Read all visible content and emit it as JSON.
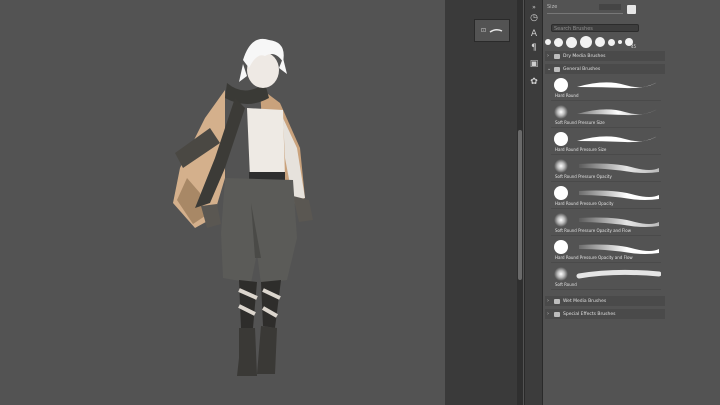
{
  "brush_panel": {
    "size_label": "Size",
    "search_placeholder": "Search Brushes",
    "preset_badge": "45",
    "groups": {
      "dry_media": "Dry Media Brushes",
      "general": "General Brushes",
      "wet_media": "Wet Media Brushes",
      "special_effects": "Special Effects Brushes"
    },
    "brushes": [
      {
        "label": "Hard Round",
        "tip": "hard",
        "stroke": "hard-taper"
      },
      {
        "label": "Soft Round Pressure Size",
        "tip": "soft",
        "stroke": "soft-taper"
      },
      {
        "label": "Hard Round Pressure Size",
        "tip": "hard",
        "stroke": "hard-taper"
      },
      {
        "label": "Soft Round Pressure Opacity",
        "tip": "soft",
        "stroke": "soft-fade"
      },
      {
        "label": "Hard Round Pressure Opacity",
        "tip": "hard",
        "stroke": "hard-fade"
      },
      {
        "label": "Soft Round Pressure Opacity and Flow",
        "tip": "soft",
        "stroke": "soft-fade"
      },
      {
        "label": "Hard Round Pressure Opacity and Flow",
        "tip": "hard",
        "stroke": "hard-fade"
      },
      {
        "label": "Soft Round",
        "tip": "soft",
        "stroke": "soft-even"
      }
    ]
  },
  "icons": {
    "history": "history-icon",
    "character": "character-icon",
    "paragraph": "paragraph-icon",
    "layers": "layers-icon",
    "brushes": "brush-icon"
  },
  "colors": {
    "canvas_bg": "#535353",
    "panel_bg": "#535353",
    "pasteboard": "#3a3a3a",
    "accent_white": "#ffffff"
  }
}
